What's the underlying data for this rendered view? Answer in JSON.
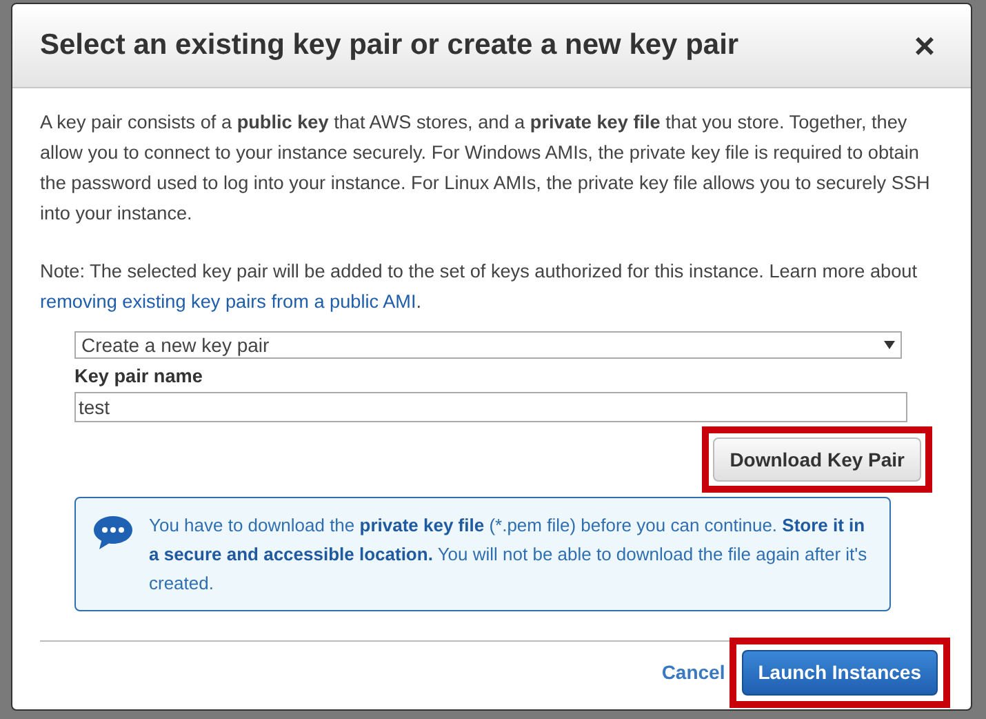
{
  "dialog": {
    "title": "Select an existing key pair or create a new key pair",
    "close": "×",
    "intro": "A key pair consists of a **public key** that AWS stores, and a **private key file** that you store. Together, they allow you to connect to your instance securely. For Windows AMIs, the private key file is required to obtain the password used to log into your instance. For Linux AMIs, the private key file allows you to securely SSH into your instance.",
    "note": "Note: The selected key pair will be added to the set of keys authorized for this instance. Learn more about",
    "note_link": "removing existing key pairs from a public AMI",
    "note_end": ".",
    "select": {
      "value": "Create a new key pair"
    },
    "name_label": "Key pair name",
    "name_field": {
      "value": "test"
    },
    "download_button": {
      "label": "Download Key Pair",
      "highlighted": true
    },
    "info": "You have to download the **private key file** (*.pem file) before you can continue. **Store it in a secure and accessible location.** You will not be able to download the file again after it's created.",
    "cancel": "Cancel",
    "launch_button": {
      "label": "Launch Instances",
      "highlighted": true
    }
  }
}
